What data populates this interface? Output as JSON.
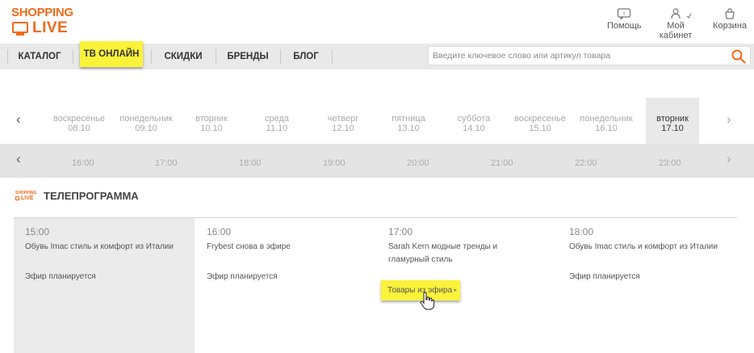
{
  "brand": {
    "line1": "SHOPPING",
    "line2": "LIVE"
  },
  "header_links": {
    "help": "Помощь",
    "cabinet": "Мой кабинет",
    "cart": "Корзина"
  },
  "nav": {
    "items": [
      "КАТАЛОГ",
      "ТВ ОНЛАЙН",
      "СКИДКИ",
      "БРЕНДЫ",
      "БЛОГ"
    ],
    "active": "ТВ ОНЛАЙН"
  },
  "search": {
    "placeholder": "Введите ключевое слово или артикул товара"
  },
  "days": [
    {
      "name": "воскресенье",
      "date": "08.10"
    },
    {
      "name": "понедельник",
      "date": "09.10"
    },
    {
      "name": "вторник",
      "date": "10.10"
    },
    {
      "name": "среда",
      "date": "11.10"
    },
    {
      "name": "четверг",
      "date": "12.10"
    },
    {
      "name": "пятница",
      "date": "13.10"
    },
    {
      "name": "суббота",
      "date": "14.10"
    },
    {
      "name": "воскресенье",
      "date": "15.10"
    },
    {
      "name": "понедельник",
      "date": "16.10"
    },
    {
      "name": "вторник",
      "date": "17.10"
    }
  ],
  "hours": [
    "16:00",
    "17:00",
    "18:00",
    "19:00",
    "20:00",
    "21:00",
    "22:00",
    "23:00"
  ],
  "section": {
    "title": "ТЕЛЕПРОГРАММА",
    "mini_logo_top": "SHOPPING",
    "mini_logo_bottom": "LIVE"
  },
  "programs": [
    {
      "time": "15:00",
      "title": "Обувь Imac стиль и комфорт из Италии",
      "status": "Эфир планируется"
    },
    {
      "time": "16:00",
      "title": "Frybest снова в эфире",
      "status": "Эфир планируется"
    },
    {
      "time": "17:00",
      "title": "Sarah Kern модные тренды и гламурный стиль",
      "status": "",
      "button": "Товары из эфира"
    },
    {
      "time": "18:00",
      "title": "Обувь Imac стиль и комфорт из Италии",
      "status": "Эфир планируется"
    }
  ],
  "colors": {
    "brand": "#f26a1b",
    "highlight": "#fbf23a",
    "navbar": "#e9e9e9"
  }
}
